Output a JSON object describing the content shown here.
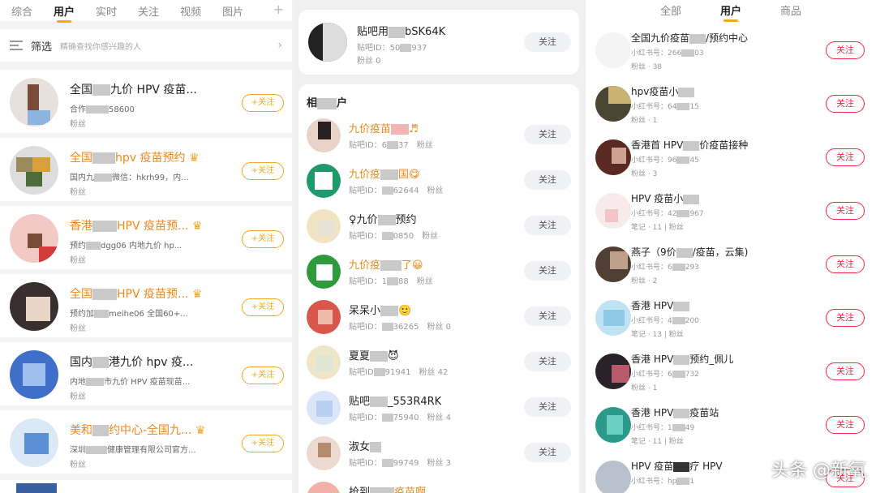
{
  "panel1": {
    "tabs": [
      "综合",
      "用户",
      "实时",
      "关注",
      "视频",
      "图片"
    ],
    "active_tab": "用户",
    "plus_icon": "+",
    "filter_label": "筛选",
    "filter_hint": "精确查找你感兴趣的人",
    "rows": [
      {
        "name": "全国",
        "name_tail": "九价 HPV 疫苗...",
        "line2": "合作",
        "line2_tail": "58600",
        "line3": "粉丝",
        "orange": false
      },
      {
        "name": "全国",
        "name_tail": "hpv 疫苗预约",
        "line2": "国内九",
        "line2_tail": "微信：hkrh99，内...",
        "line3": "粉丝",
        "orange": true
      },
      {
        "name": "香港",
        "name_tail": "HPV 疫苗预...",
        "line2": "预约",
        "line2_tail": "dgg06 内地九价 hp...",
        "line3": "粉丝",
        "orange": true
      },
      {
        "name": "全国",
        "name_tail": "HPV 疫苗预...",
        "line2": "预约加",
        "line2_tail": "meihe06 全国60+...",
        "line3": "粉丝",
        "orange": true
      },
      {
        "name": "国内",
        "name_tail": "港九价 hpv 疫...",
        "line2": "内地",
        "line2_tail": "市九价 HPV 疫苗现苗...",
        "line3": "粉丝",
        "orange": false
      },
      {
        "name": "美和",
        "name_tail": "约中心-全国九...",
        "line2": "深圳",
        "line2_tail": "健康管理有限公司官方...",
        "line3": "粉丝",
        "orange": true
      }
    ],
    "follow_label": "+关注"
  },
  "panel2": {
    "top_user": {
      "name": "贴吧用",
      "name_tail": "bSK64K",
      "id": "贴吧ID：50",
      "id_tail": "937",
      "fans": "粉丝 0"
    },
    "section_title": "相",
    "section_tail": "户",
    "rows": [
      {
        "name": "九价疫苗",
        "name_tail": "♬",
        "id": "贴吧ID：6",
        "id_tail": "37",
        "fans": "粉丝",
        "orange": true
      },
      {
        "name": "九价疫",
        "name_tail": "国😋",
        "id": "贴吧ID：",
        "id_tail": "62644",
        "fans": "粉丝",
        "orange": true
      },
      {
        "name": "♀九价",
        "name_tail": "预约",
        "id": "贴吧ID：",
        "id_tail": "0850",
        "fans": "粉丝",
        "orange": false
      },
      {
        "name": "九价疫",
        "name_tail": "了😀",
        "id": "贴吧ID：1",
        "id_tail": "88",
        "fans": "粉丝",
        "orange": true
      },
      {
        "name": "呆呆小",
        "name_tail": "🙂",
        "id": "贴吧ID：",
        "id_tail": "36265",
        "fans": "粉丝 0",
        "orange": false
      },
      {
        "name": "夏夏",
        "name_tail": "😈",
        "id": "贴吧ID",
        "id_tail": "91941",
        "fans": "粉丝 42",
        "orange": false
      },
      {
        "name": "贴吧",
        "name_tail": "_553R4RK",
        "id": "贴吧ID：",
        "id_tail": "75940",
        "fans": "粉丝 4",
        "orange": false
      },
      {
        "name": "淑女",
        "name_tail": "",
        "id": "贴吧ID：",
        "id_tail": "99749",
        "fans": "粉丝 3",
        "orange": false
      },
      {
        "name": "抢到",
        "name_tail": "疫苗啊",
        "id": "",
        "id_tail": "",
        "fans": "",
        "orange": true
      }
    ],
    "follow_label": "关注"
  },
  "panel3": {
    "tabs": [
      "全部",
      "用户",
      "商品"
    ],
    "active_tab": "用户",
    "rows": [
      {
        "name": "全国九价疫苗",
        "name_tail": "/预约中心",
        "line2": "小红书号：266",
        "line2_tail": "03",
        "line3": "粉丝 · 38"
      },
      {
        "name": "hpv疫苗小",
        "name_tail": "",
        "line2": "小红书号：64",
        "line2_tail": "15",
        "line3": "粉丝 · 1"
      },
      {
        "name": "香港首 HPV",
        "name_tail": "价疫苗接种",
        "line2": "小红书号：96",
        "line2_tail": "45",
        "line3": "粉丝 · 3"
      },
      {
        "name": "HPV 疫苗小",
        "name_tail": "",
        "line2": "小红书号：42",
        "line2_tail": "967",
        "line3": "笔记 · 11 | 粉丝"
      },
      {
        "name": "燕子（9价",
        "name_tail": "/疫苗，云集)",
        "line2": "小红书号：6",
        "line2_tail": "293",
        "line3": "粉丝 · 2"
      },
      {
        "name": "香港 HPV",
        "name_tail": "",
        "line2": "小红书号：4",
        "line2_tail": "200",
        "line3": "笔记 · 13 | 粉丝"
      },
      {
        "name": "香港 HPV",
        "name_tail": "预约_佩儿",
        "line2": "小红书号：6",
        "line2_tail": "732",
        "line3": "粉丝 · 1"
      },
      {
        "name": "香港 HPV",
        "name_tail": "疫苗站",
        "line2": "小红书号：1",
        "line2_tail": "49",
        "line3": "笔记 · 11 | 粉丝"
      },
      {
        "name": "HPV 疫苗",
        "name_tail": "疗 HPV",
        "line2": "小红书号：hp",
        "line2_tail": "1",
        "line3": ""
      }
    ],
    "follow_label": "关注"
  },
  "watermark": "头条 @新氧"
}
